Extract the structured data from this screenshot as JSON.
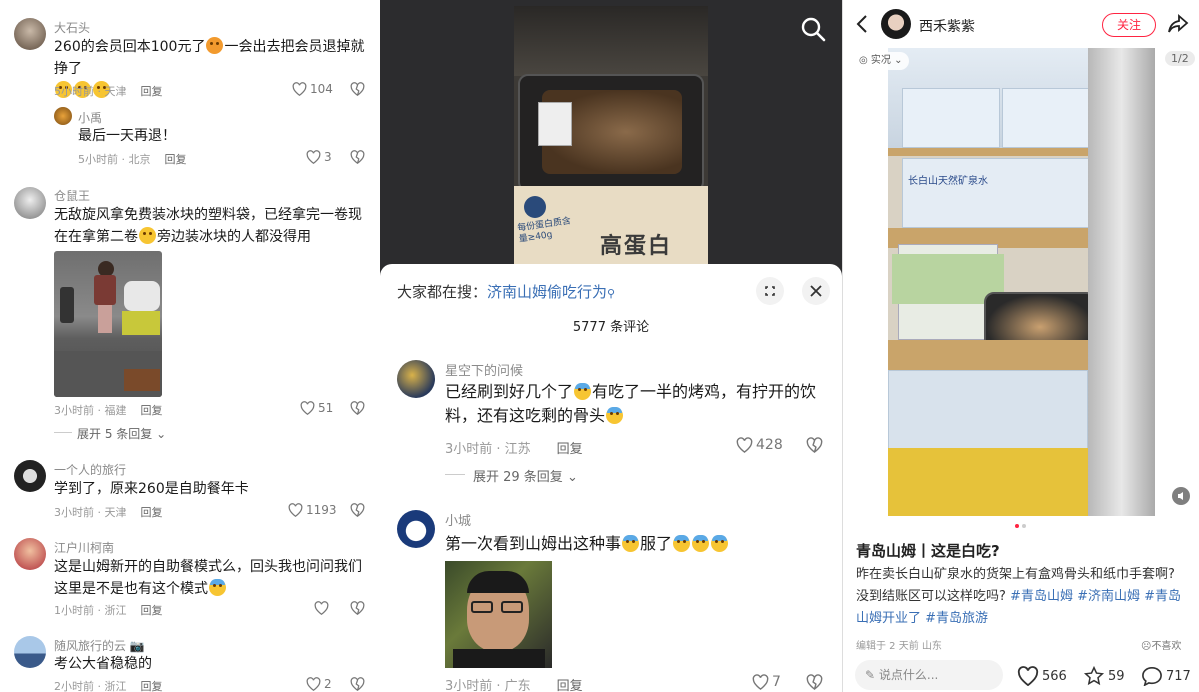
{
  "left_panel": {
    "comments": [
      {
        "user": "大石头",
        "text": "260的会员回本100元了",
        "text2": "一会出去把会员退掉就挣了",
        "meta_time": "5小时前 · 天津",
        "reply": "回复",
        "likes": "104"
      },
      {
        "user": "小禹",
        "text": "最后一天再退！",
        "meta_time": "5小时前 · 北京",
        "reply": "回复",
        "likes": "3"
      },
      {
        "user": "仓鼠王",
        "text": "无敌旋风拿免费装冰块的塑料袋，已经拿完一卷现在在拿第二卷",
        "text2": "旁边装冰块的人都没得用",
        "meta_time": "3小时前 · 福建",
        "reply": "回复",
        "likes": "51",
        "expand": "展开 5 条回复"
      },
      {
        "user": "一个人的旅行",
        "text": "学到了，原来260是自助餐年卡",
        "meta_time": "3小时前 · 天津",
        "reply": "回复",
        "likes": "1193"
      },
      {
        "user": "江户川柯南",
        "text": "这是山姆新开的自助餐模式么，回头我也问问我们这里是不是也有这个模式",
        "meta_time": "1小时前 · 浙江",
        "reply": "回复",
        "likes": ""
      },
      {
        "user": "随风旅行的云",
        "text": "考公大省稳稳的",
        "meta_time": "2小时前 · 浙江",
        "reply": "回复",
        "likes": "2"
      }
    ]
  },
  "middle_panel": {
    "product_label": "高蛋白",
    "product_sub": "每份蛋白质含量≥40g",
    "search_prefix": "大家都在搜：",
    "search_term": "济南山姆偷吃行为",
    "comment_count": "5777 条评论",
    "comments": [
      {
        "user": "星空下的问候",
        "text": "已经刷到好几个了",
        "text2": "有吃了一半的烤鸡，有拧开的饮料，还有这吃剩的骨头",
        "meta_time": "3小时前 · 江苏",
        "reply": "回复",
        "likes": "428",
        "expand": "展开 29 条回复"
      },
      {
        "user": "小城",
        "text": "第一次看到山姆出这种事",
        "text2": "服了",
        "meta_time": "3小时前 · 广东",
        "reply": "回复",
        "likes": "7"
      }
    ]
  },
  "right_panel": {
    "author": "西禾紫紫",
    "follow_label": "关注",
    "live_tag": "实况",
    "page_indicator": "1/2",
    "box_label": "长白山天然矿泉水",
    "title": "青岛山姆丨这是白吃?",
    "body": "昨在卖长白山矿泉水的货架上有盒鸡骨头和纸巾手套啊?没到结账区可以这样吃吗?",
    "tags": [
      "#青岛山姆",
      "#济南山姆",
      "#青岛山姆开业了",
      "#青岛旅游"
    ],
    "edit_info": "编辑于 2 天前 山东",
    "dislike_label": "不喜欢",
    "comment_placeholder": "说点什么...",
    "likes": "566",
    "stars": "59",
    "comments": "717"
  },
  "colors": {
    "accent_red": "#ff2442",
    "link_blue": "#3a6fb5",
    "follow_red": "#ff2442"
  }
}
